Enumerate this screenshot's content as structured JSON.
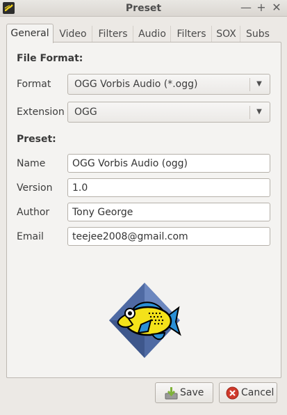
{
  "window": {
    "title": "Preset"
  },
  "icons": {
    "app": "selene-app-icon",
    "minimize": "minimize-icon",
    "maximize": "maximize-icon",
    "close": "close-icon",
    "save": "save-icon",
    "cancel": "cancel-icon",
    "logo": "vorbis-fish-logo"
  },
  "window_controls": {
    "minimize": "—",
    "maximize": "+",
    "close": "✕"
  },
  "tabs": [
    {
      "label": "General",
      "active": true
    },
    {
      "label": "Video"
    },
    {
      "label": "Filters"
    },
    {
      "label": "Audio"
    },
    {
      "label": "Filters"
    },
    {
      "label": "SOX"
    },
    {
      "label": "Subs"
    }
  ],
  "file_format": {
    "heading": "File Format:",
    "format_label": "Format",
    "format_value": "OGG Vorbis Audio (*.ogg)",
    "extension_label": "Extension",
    "extension_value": "OGG"
  },
  "preset": {
    "heading": "Preset:",
    "name_label": "Name",
    "name_value": "OGG Vorbis Audio (ogg)",
    "version_label": "Version",
    "version_value": "1.0",
    "author_label": "Author",
    "author_value": "Tony George",
    "email_label": "Email",
    "email_value": "teejee2008@gmail.com"
  },
  "buttons": {
    "save": "Save",
    "cancel": "Cancel"
  },
  "colors": {
    "save_icon": "#7fb23a",
    "cancel_icon": "#d03a2c",
    "fish_body": "#f4e21a",
    "fish_fins": "#2a8fd6",
    "diamond": "#4f6aa3"
  }
}
